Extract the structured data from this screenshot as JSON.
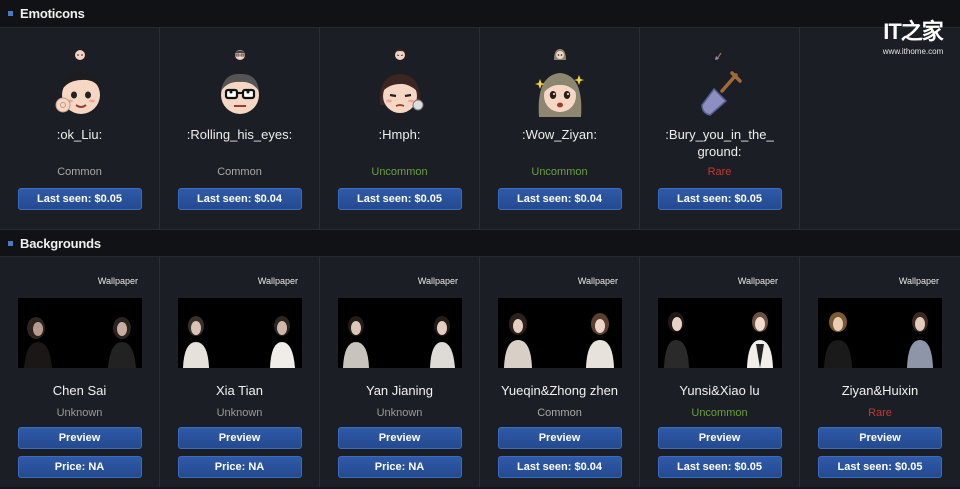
{
  "emoticons_section": {
    "title": "Emoticons"
  },
  "emoticons": [
    {
      "name": ":ok_Liu:",
      "rarity": "Common",
      "rarity_class": "common",
      "button": "Last seen: $0.05",
      "icon": "ok-liu-emoticon-icon"
    },
    {
      "name": ":Rolling_his_eyes:",
      "rarity": "Common",
      "rarity_class": "common",
      "button": "Last seen: $0.04",
      "icon": "rolling-eyes-emoticon-icon"
    },
    {
      "name": ":Hmph:",
      "rarity": "Uncommon",
      "rarity_class": "uncommon",
      "button": "Last seen: $0.05",
      "icon": "hmph-emoticon-icon"
    },
    {
      "name": ":Wow_Ziyan:",
      "rarity": "Uncommon",
      "rarity_class": "uncommon",
      "button": "Last seen: $0.04",
      "icon": "wow-ziyan-emoticon-icon"
    },
    {
      "name": ":Bury_you_in_the_ground:",
      "rarity": "Rare",
      "rarity_class": "rare",
      "button": "Last seen: $0.05",
      "icon": "shovel-emoticon-icon"
    }
  ],
  "backgrounds_section": {
    "title": "Backgrounds"
  },
  "backgrounds": [
    {
      "type": "Wallpaper",
      "name": "Chen Sai",
      "rarity": "Unknown",
      "rarity_class": "unknown",
      "preview": "Preview",
      "button": "Price: NA"
    },
    {
      "type": "Wallpaper",
      "name": "Xia Tian",
      "rarity": "Unknown",
      "rarity_class": "unknown",
      "preview": "Preview",
      "button": "Price: NA"
    },
    {
      "type": "Wallpaper",
      "name": "Yan Jianing",
      "rarity": "Unknown",
      "rarity_class": "unknown",
      "preview": "Preview",
      "button": "Price: NA"
    },
    {
      "type": "Wallpaper",
      "name": "Yueqin&Zhong zhen",
      "rarity": "Common",
      "rarity_class": "common",
      "preview": "Preview",
      "button": "Last seen: $0.04"
    },
    {
      "type": "Wallpaper",
      "name": "Yunsi&Xiao lu",
      "rarity": "Uncommon",
      "rarity_class": "uncommon",
      "preview": "Preview",
      "button": "Last seen: $0.05"
    },
    {
      "type": "Wallpaper",
      "name": "Ziyan&Huixin",
      "rarity": "Rare",
      "rarity_class": "rare",
      "preview": "Preview",
      "button": "Last seen: $0.05"
    }
  ],
  "watermark": {
    "logo": "IT之家",
    "site": "www.ithome.com"
  },
  "colors": {
    "accent": "#2f5aa8",
    "common": "#a8a8a8",
    "uncommon": "#6aa03a",
    "rare": "#c3382f"
  }
}
